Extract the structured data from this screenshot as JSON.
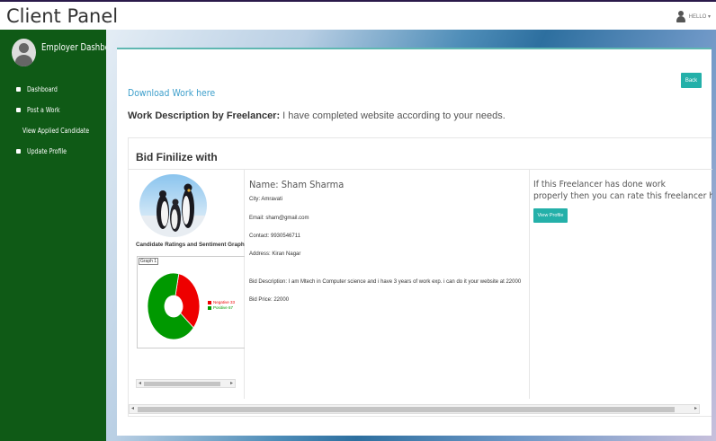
{
  "app": {
    "title": "Client Panel"
  },
  "user": {
    "greeting": "HELLO ▾"
  },
  "sidebar": {
    "profile_name": "Employer Dashboard",
    "items": [
      {
        "label": "Dashboard",
        "icon": "dashboard-icon"
      },
      {
        "label": "Post a Work",
        "icon": "home-icon"
      },
      {
        "label": "View Applied Candidate",
        "icon": "list-icon"
      },
      {
        "label": "Update Profile",
        "icon": "user-icon"
      }
    ]
  },
  "main": {
    "back_label": "Back",
    "download_link": "Download Work here",
    "work_desc_label": "Work Description by Freelancer:",
    "work_desc_value": " I have completed website according to your needs."
  },
  "bid": {
    "title": "Bid Finilize with",
    "ratings_title": "Candidate Ratings and Sentiment Graph",
    "graph_label": "Graph 1",
    "candidate": {
      "name": "Name: Sham Sharma",
      "city": "City: Amravati",
      "email": "Email: sham@gmail.com",
      "contact": "Contact: 9930546711",
      "address": "Address: Kiran Nagar",
      "description": "Bid Description: I am Mtech in Computer science and i have 3 years of work exp. i can do it your website at 22000",
      "price": "Bid Price: 22000"
    },
    "rate_line1": "If this Freelancer has done work",
    "rate_line2": "properly then you can rate this freelancer he",
    "view_profile_label": "View Profile"
  },
  "chart_data": {
    "type": "pie",
    "title": "Graph 1",
    "categories": [
      "Negative",
      "Positive"
    ],
    "legend": [
      "Negative 33",
      "Positive 67"
    ],
    "values": [
      33,
      67
    ],
    "colors": [
      "#ee0000",
      "#009900"
    ]
  }
}
